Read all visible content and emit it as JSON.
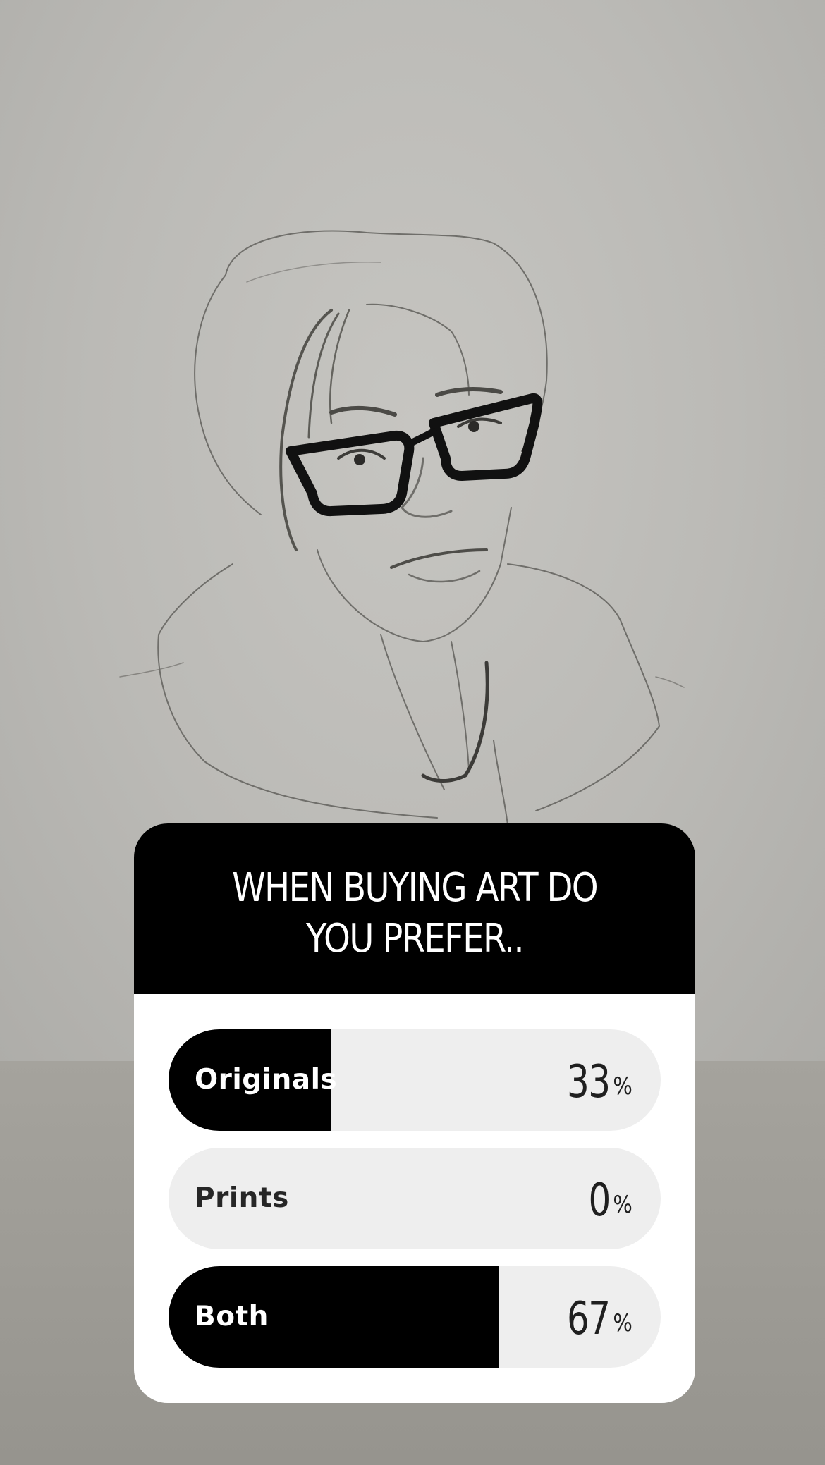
{
  "poll": {
    "question": "WHEN BUYING ART DO YOU PREFER..",
    "options": [
      {
        "label": "Originals",
        "percent_value": 33,
        "percent_text": "33",
        "percent_sign": "%"
      },
      {
        "label": "Prints",
        "percent_value": 0,
        "percent_text": "0",
        "percent_sign": "%"
      },
      {
        "label": "Both",
        "percent_value": 67,
        "percent_text": "67",
        "percent_sign": "%"
      }
    ]
  },
  "colors": {
    "fill": "#000000",
    "track": "#eeeeee",
    "label_on_fill": "#ffffff",
    "label_on_track": "#262626"
  }
}
